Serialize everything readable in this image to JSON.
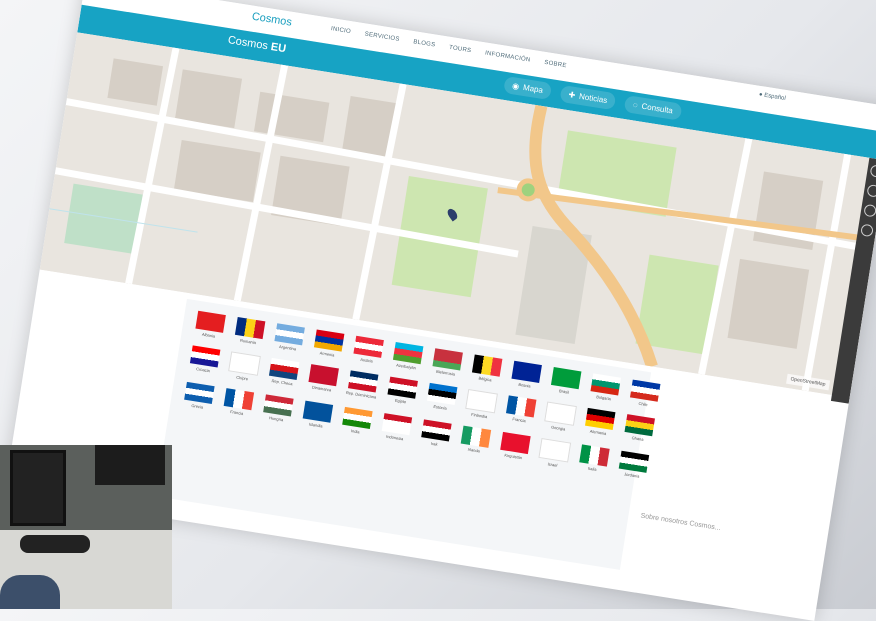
{
  "header": {
    "logo_text": "Cosmos",
    "nav": [
      "INICIO",
      "SERVICIOS",
      "BLOGS",
      "TOURS",
      "INFORMACIÓN",
      "SOBRE"
    ]
  },
  "subheader": {
    "brand_prefix": "Cosmos ",
    "brand_suffix": "EU",
    "buttons": [
      {
        "label": "Mapa",
        "icon": "map-icon"
      },
      {
        "label": "Noticias",
        "icon": "news-icon"
      },
      {
        "label": "Consulta",
        "icon": "chat-icon"
      }
    ],
    "language": "Español"
  },
  "map": {
    "attribution": "OpenStreetMap",
    "marker_icon": "location-pin-icon"
  },
  "flags": [
    {
      "name": "Albania"
    },
    {
      "name": "Rumania"
    },
    {
      "name": "Argentina"
    },
    {
      "name": "Armenia"
    },
    {
      "name": "Austria"
    },
    {
      "name": "Azerbaiyán"
    },
    {
      "name": "Bielorrusia"
    },
    {
      "name": "Bélgica"
    },
    {
      "name": "Bosnia"
    },
    {
      "name": "Brasil"
    },
    {
      "name": "Bulgaria"
    },
    {
      "name": "Chile"
    },
    {
      "name": "Croacia"
    },
    {
      "name": "Chipre"
    },
    {
      "name": "Rep. Checa"
    },
    {
      "name": "Dinamarca"
    },
    {
      "name": "Rep. Dominicana"
    },
    {
      "name": "Egipto"
    },
    {
      "name": "Estonia"
    },
    {
      "name": "Finlandia"
    },
    {
      "name": "Francia"
    },
    {
      "name": "Georgia"
    },
    {
      "name": "Alemania"
    },
    {
      "name": "Ghana"
    },
    {
      "name": "Grecia"
    },
    {
      "name": "Francia"
    },
    {
      "name": "Hungría"
    },
    {
      "name": "Islandia"
    },
    {
      "name": "India"
    },
    {
      "name": "Indonesia"
    },
    {
      "name": "Irak"
    },
    {
      "name": "Irlanda"
    },
    {
      "name": "Kirguistán"
    },
    {
      "name": "Israel"
    },
    {
      "name": "Italia"
    },
    {
      "name": "Jordania"
    }
  ],
  "side_note": "Sobre nosotros Cosmos...",
  "colors": {
    "accent": "#17a3c4",
    "map_road": "#f2c78a",
    "park": "#c8e0a8"
  }
}
